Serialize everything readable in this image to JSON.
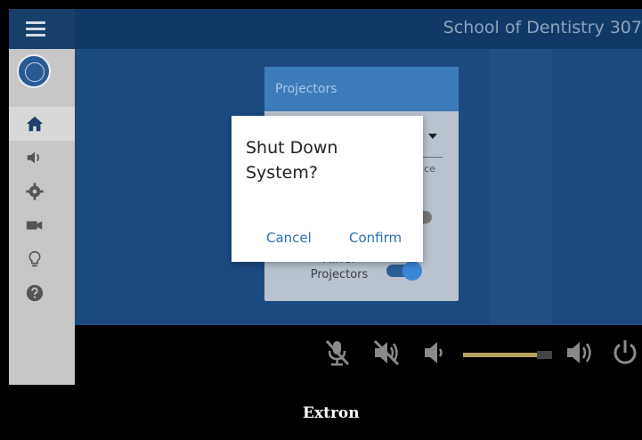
{
  "header": {
    "room_title": "School of Dentistry 307"
  },
  "sidebar": {
    "items": [
      {
        "name": "home",
        "icon": "home-icon",
        "active": true
      },
      {
        "name": "audio",
        "icon": "speaker-icon"
      },
      {
        "name": "settings",
        "icon": "gear-icon"
      },
      {
        "name": "video",
        "icon": "camera-icon"
      },
      {
        "name": "lighting",
        "icon": "lightbulb-icon"
      },
      {
        "name": "help",
        "icon": "help-icon"
      }
    ]
  },
  "projectors_panel": {
    "title": "Projectors",
    "partial_text": "ce",
    "mirror_label": "Mirror Projectors",
    "mirror_on": true
  },
  "dialog": {
    "title": "Shut Down System?",
    "cancel_label": "Cancel",
    "confirm_label": "Confirm"
  },
  "controls": {
    "mic_muted": true,
    "speaker_muted": true,
    "volume_level": 0.83
  },
  "footer": {
    "brand": "Extron"
  },
  "colors": {
    "accent": "#3c7cbb",
    "button_text": "#2c6fb0",
    "volume_fill": "#b6a462"
  }
}
